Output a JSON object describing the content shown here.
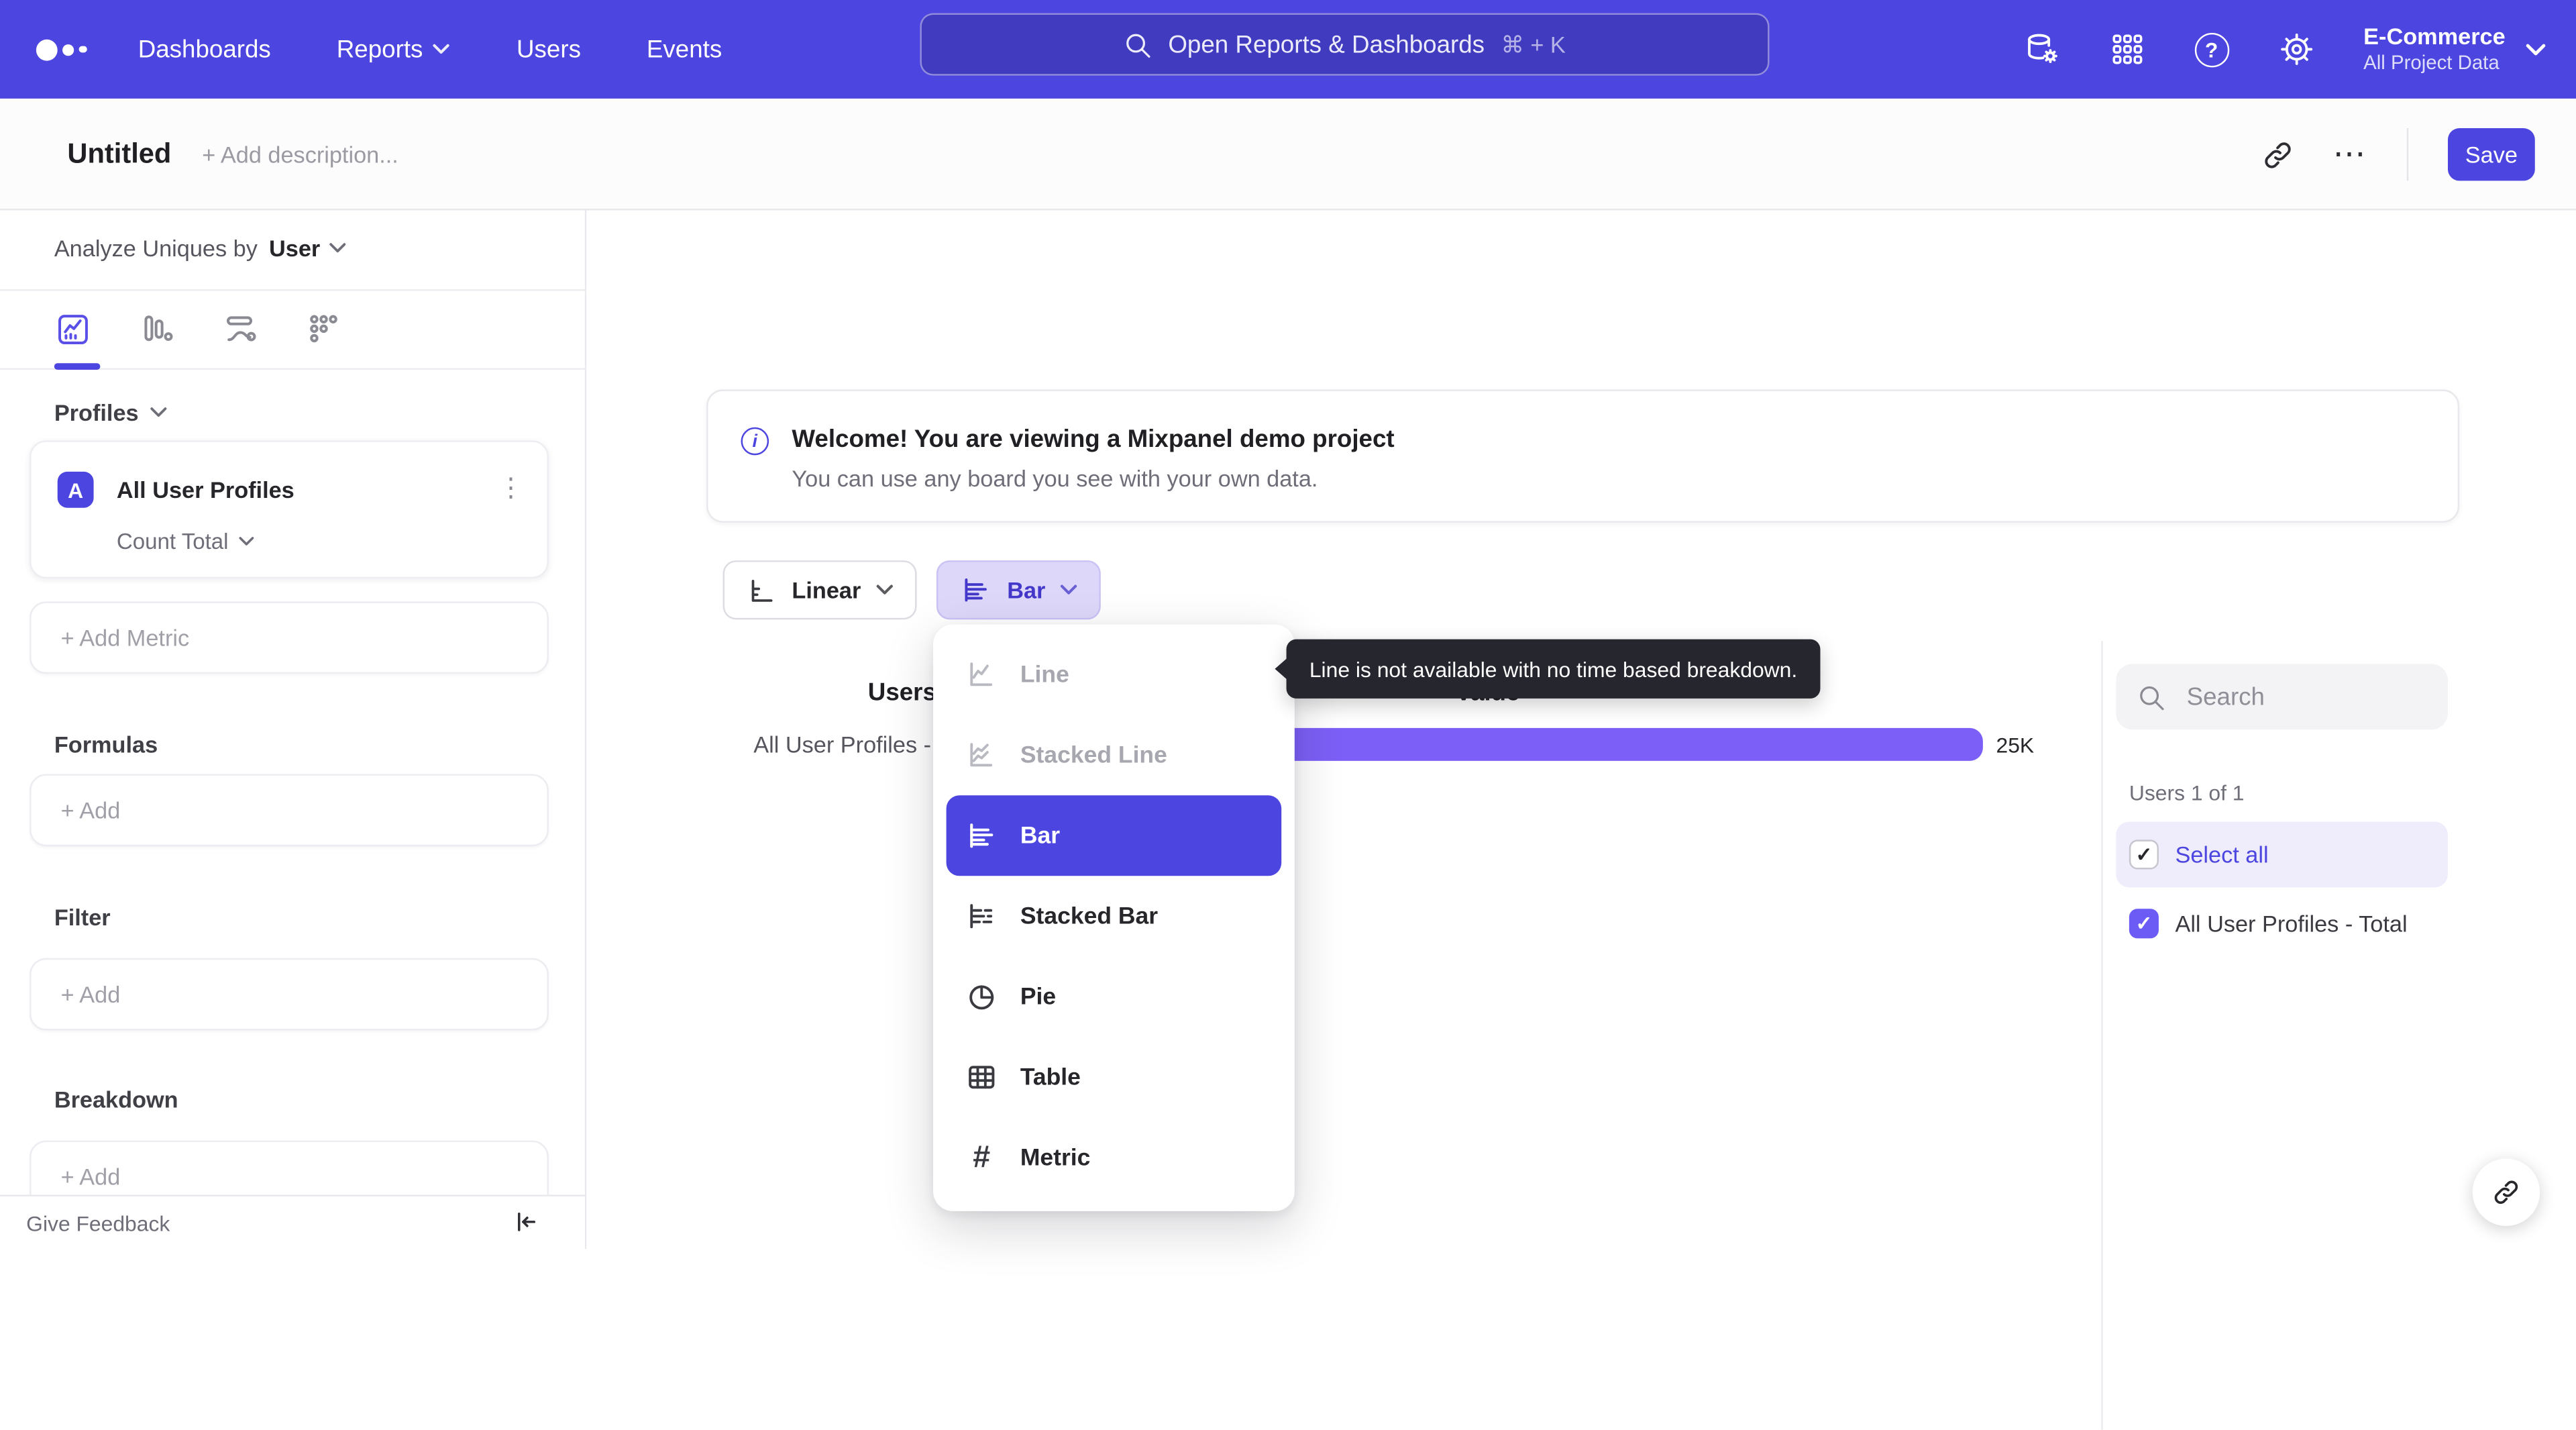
{
  "brand": {
    "accent_color": "#4c45e0",
    "bar_color": "#7c5ff6",
    "selected_menu_color": "#4c45e0"
  },
  "topnav": {
    "items": [
      {
        "label": "Dashboards",
        "chevron": false
      },
      {
        "label": "Reports",
        "chevron": true
      },
      {
        "label": "Users",
        "chevron": false
      },
      {
        "label": "Events",
        "chevron": false
      }
    ],
    "search": {
      "placeholder": "Open Reports & Dashboards",
      "shortcut": "⌘ + K"
    },
    "icons": [
      "data-management-icon",
      "apps-grid-icon",
      "help-icon",
      "settings-gear-icon"
    ],
    "account": {
      "name": "E-Commerce",
      "subtitle": "All Project Data"
    }
  },
  "titlebar": {
    "title": "Untitled",
    "description_placeholder": "+ Add description...",
    "more_glyph": "⋯",
    "save_label": "Save"
  },
  "sidebar": {
    "analyze": {
      "prefix": "Analyze Uniques by",
      "value": "User"
    },
    "profiles_heading": "Profiles",
    "metric_card": {
      "badge": "A",
      "name": "All User Profiles",
      "aggregation": "Count Total",
      "kebab_glyph": "⋮"
    },
    "add_metric_label": "+ Add Metric",
    "sections": [
      {
        "heading": "Formulas",
        "add_label": "+ Add"
      },
      {
        "heading": "Filter",
        "add_label": "+ Add"
      },
      {
        "heading": "Breakdown",
        "add_label": "+ Add"
      }
    ],
    "feedback_label": "Give Feedback"
  },
  "banner": {
    "info_glyph": "i",
    "title": "Welcome! You are viewing a Mixpanel demo project",
    "subtitle": "You can use any board you see with your own data."
  },
  "controls": {
    "scale_label": "Linear",
    "chart_type_label": "Bar"
  },
  "chart_menu": {
    "metric_glyph": "#",
    "items": [
      {
        "label": "Line",
        "state": "disabled"
      },
      {
        "label": "Stacked Line",
        "state": "disabled"
      },
      {
        "label": "Bar",
        "state": "selected"
      },
      {
        "label": "Stacked Bar",
        "state": "default"
      },
      {
        "label": "Pie",
        "state": "default"
      },
      {
        "label": "Table",
        "state": "default"
      },
      {
        "label": "Metric",
        "state": "default"
      }
    ]
  },
  "tooltip": {
    "text": "Line is not available with no time based breakdown."
  },
  "chart_data": {
    "type": "bar",
    "orientation": "horizontal",
    "columns": {
      "category_header": "Users",
      "value_header": "Value"
    },
    "categories": [
      "All User Profiles - Total"
    ],
    "values": [
      25000
    ],
    "value_labels": [
      "25K"
    ],
    "series": [
      {
        "name": "All User Profiles - Total",
        "values": [
          25000
        ]
      }
    ],
    "xlim": [
      0,
      25000
    ],
    "bar_color": "#7c5ff6",
    "grid": false,
    "legend": "none"
  },
  "right_panel": {
    "search_placeholder": "Search",
    "count_label": "Users 1 of 1",
    "select_all_label": "Select all",
    "items": [
      {
        "label": "All User Profiles - Total",
        "checked": true
      }
    ]
  }
}
